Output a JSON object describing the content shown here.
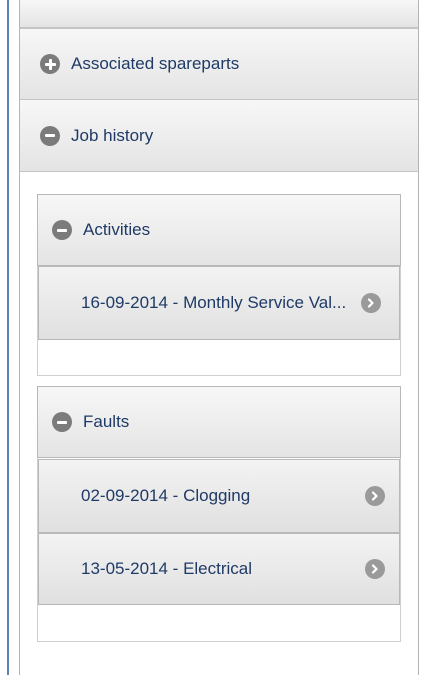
{
  "associated_spareparts": {
    "label": "Associated spareparts",
    "icon": "plus-circle-icon"
  },
  "job_history": {
    "label": "Job history",
    "icon": "minus-circle-icon"
  },
  "activities": {
    "label": "Activities",
    "icon": "minus-circle-icon",
    "items": [
      {
        "label": "16-09-2014 - Monthly Service Val...",
        "icon": "chevron-right-icon"
      }
    ]
  },
  "faults": {
    "label": "Faults",
    "icon": "minus-circle-icon",
    "items": [
      {
        "label": "02-09-2014 - Clogging",
        "icon": "chevron-right-icon"
      },
      {
        "label": "13-05-2014 - Electrical",
        "icon": "chevron-right-icon"
      }
    ]
  },
  "colors": {
    "text": "#1f3a66",
    "icon_gray": "#7b7b7b",
    "border_accent": "#5b82b5"
  }
}
